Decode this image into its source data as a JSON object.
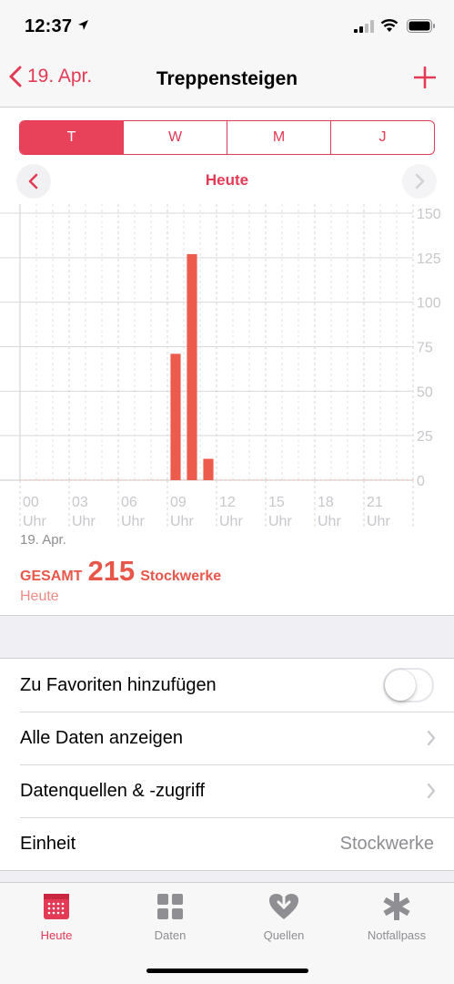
{
  "status": {
    "time": "12:37"
  },
  "nav": {
    "back_label": "19. Apr.",
    "title": "Treppensteigen"
  },
  "segments": [
    "T",
    "W",
    "M",
    "J"
  ],
  "selected_segment": "T",
  "day_label": "Heute",
  "chart_data": {
    "type": "bar",
    "x_ticks": [
      {
        "hour": "00",
        "unit": "Uhr"
      },
      {
        "hour": "03",
        "unit": "Uhr"
      },
      {
        "hour": "06",
        "unit": "Uhr"
      },
      {
        "hour": "09",
        "unit": "Uhr"
      },
      {
        "hour": "12",
        "unit": "Uhr"
      },
      {
        "hour": "15",
        "unit": "Uhr"
      },
      {
        "hour": "18",
        "unit": "Uhr"
      },
      {
        "hour": "21",
        "unit": "Uhr"
      }
    ],
    "y_ticks": [
      0,
      25,
      50,
      75,
      100,
      125,
      150
    ],
    "ylim": [
      0,
      150
    ],
    "xlim_hours": [
      0,
      24
    ],
    "grid": true,
    "color": "#ec5b4b",
    "bars": [
      {
        "hour": 9,
        "value": 71
      },
      {
        "hour": 10,
        "value": 127
      },
      {
        "hour": 11,
        "value": 12
      }
    ]
  },
  "chart_date": "19. Apr.",
  "summary": {
    "label": "GESAMT",
    "total": "215",
    "unit": "Stockwerke",
    "period": "Heute"
  },
  "settings": {
    "favorites": {
      "label": "Zu Favoriten hinzufügen",
      "enabled": false
    },
    "all_data": {
      "label": "Alle Daten anzeigen"
    },
    "sources": {
      "label": "Datenquellen & -zugriff"
    },
    "unit": {
      "label": "Einheit",
      "value": "Stockwerke"
    }
  },
  "tabs": [
    {
      "label": "Heute",
      "icon": "calendar-icon",
      "active": true
    },
    {
      "label": "Daten",
      "icon": "grid-icon",
      "active": false
    },
    {
      "label": "Quellen",
      "icon": "heart-download-icon",
      "active": false
    },
    {
      "label": "Notfallpass",
      "icon": "asterisk-icon",
      "active": false
    }
  ],
  "colors": {
    "accent": "#e33a55",
    "bar": "#ec5b4b"
  }
}
